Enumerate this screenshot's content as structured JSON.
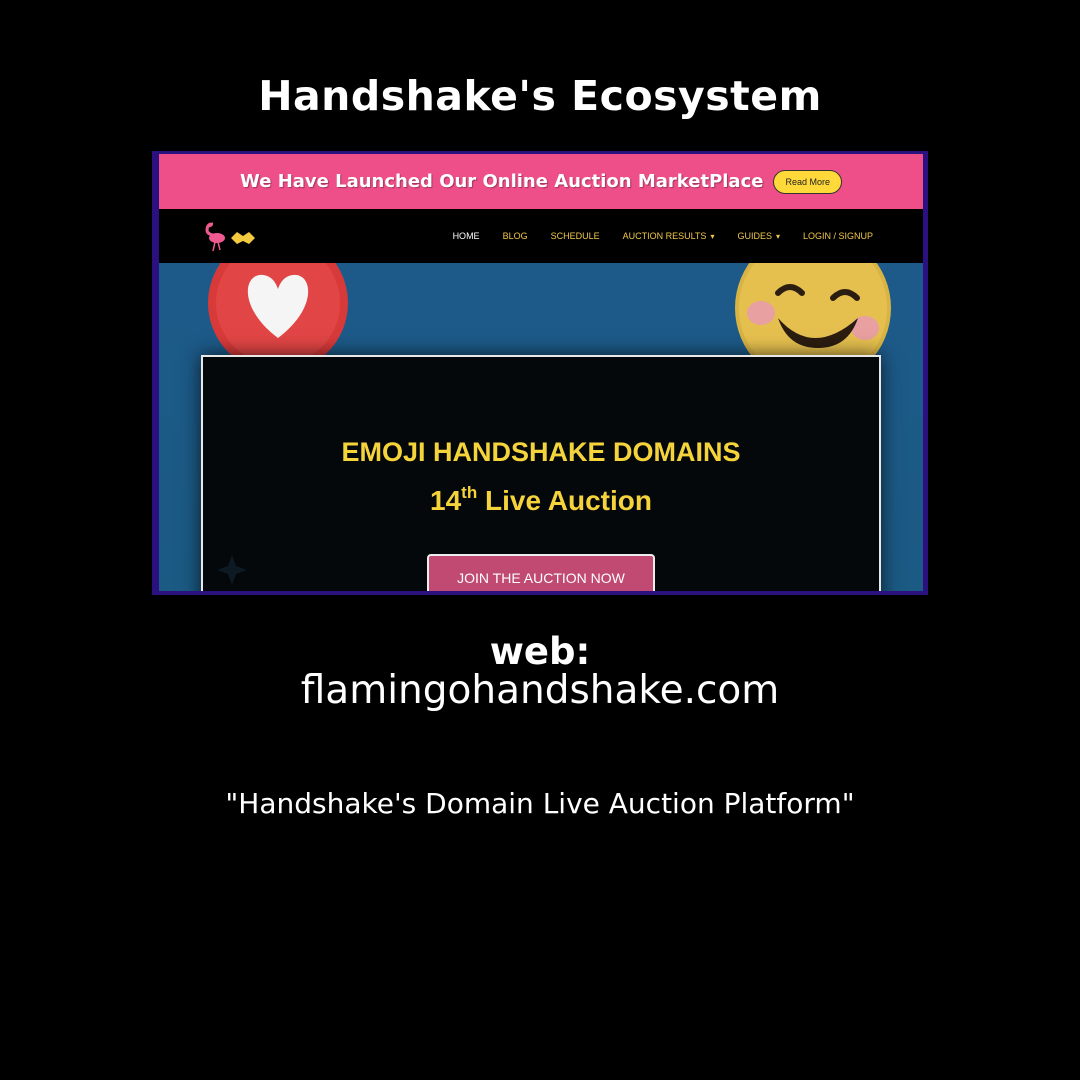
{
  "title": "Handshake's Ecosystem",
  "screenshot": {
    "banner": {
      "text": "We Have Launched Our Online Auction MarketPlace",
      "button": "Read More"
    },
    "nav": {
      "items": [
        {
          "label": "HOME"
        },
        {
          "label": "BLOG"
        },
        {
          "label": "SCHEDULE"
        },
        {
          "label": "AUCTION RESULTS",
          "chevron": "▾"
        },
        {
          "label": "GUIDES",
          "chevron": "▾"
        },
        {
          "label": "LOGIN / SIGNUP"
        }
      ]
    },
    "hero": {
      "title": "EMOJI HANDSHAKE DOMAINS",
      "number": "14",
      "suffix": "th",
      "sub": "Live Auction",
      "button": "JOIN THE AUCTION NOW"
    },
    "icons": [
      "flamingo-logo-icon",
      "handshake-logo-icon",
      "heart-emoji-icon",
      "smile-emoji-icon",
      "sparkle-icon"
    ]
  },
  "web_label": "web:",
  "web_url": "flamingohandshake.com",
  "tagline": "\"Handshake's Domain Live Auction Platform\""
}
